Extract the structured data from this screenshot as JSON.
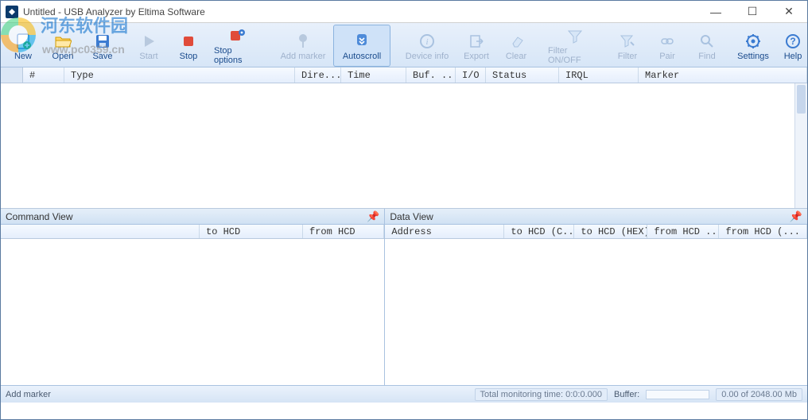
{
  "window": {
    "title": "Untitled - USB Analyzer by Eltima Software"
  },
  "toolbar": {
    "new": {
      "label": "New",
      "icon": "file-new"
    },
    "open": {
      "label": "Open",
      "icon": "folder-open"
    },
    "save": {
      "label": "Save",
      "icon": "save"
    },
    "start": {
      "label": "Start",
      "icon": "play"
    },
    "stop": {
      "label": "Stop",
      "icon": "stop"
    },
    "stop_options": {
      "label": "Stop options",
      "icon": "stop-gear"
    },
    "add_marker": {
      "label": "Add marker",
      "icon": "marker-pin"
    },
    "autoscroll": {
      "label": "Autoscroll",
      "icon": "scroll-down"
    },
    "device_info": {
      "label": "Device info",
      "icon": "info"
    },
    "export": {
      "label": "Export",
      "icon": "export"
    },
    "clear": {
      "label": "Clear",
      "icon": "eraser"
    },
    "filter_onoff": {
      "label": "Filter ON/OFF",
      "icon": "funnel"
    },
    "filter": {
      "label": "Filter",
      "icon": "funnel-edit"
    },
    "pair": {
      "label": "Pair",
      "icon": "link"
    },
    "find": {
      "label": "Find",
      "icon": "search"
    },
    "settings": {
      "label": "Settings",
      "icon": "gear"
    },
    "help": {
      "label": "Help",
      "icon": "help"
    }
  },
  "grid": {
    "columns": [
      "#",
      "Type",
      "Dire...",
      "Time",
      "Buf. ...",
      "I/O",
      "Status",
      "IRQL",
      "Marker"
    ]
  },
  "panes": {
    "command": {
      "title": "Command View",
      "columns": [
        "",
        "to HCD",
        "from HCD"
      ]
    },
    "data": {
      "title": "Data View",
      "columns": [
        "Address",
        "to HCD (C...",
        "to HCD (HEX)",
        "from HCD ...",
        "from HCD (..."
      ]
    }
  },
  "status": {
    "add_marker": "Add marker",
    "total_time_label": "Total monitoring time:",
    "total_time_value": "0:0:0.000",
    "buffer_label": "Buffer:",
    "buffer_text": "0.00 of 2048.00 Mb"
  },
  "watermark": {
    "text": "河东软件园",
    "url": "www.pc0359.cn"
  }
}
